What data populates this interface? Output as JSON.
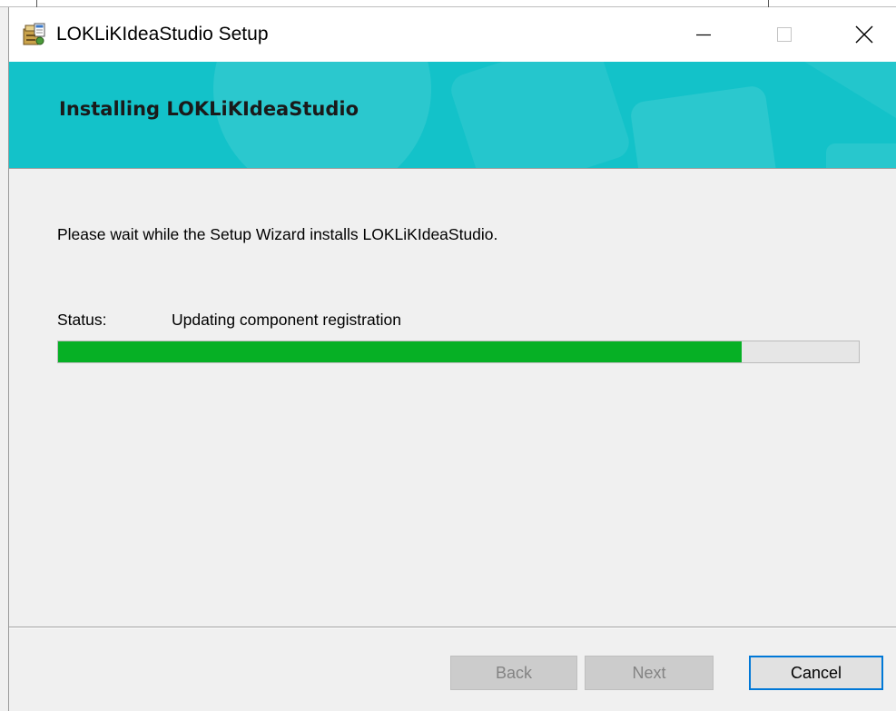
{
  "window": {
    "title": "LOKLiKIdeaStudio Setup",
    "icon": "installer-package-icon"
  },
  "controls": {
    "minimize_icon": "minimize-icon",
    "maximize_icon": "maximize-icon",
    "close_icon": "close-icon"
  },
  "banner": {
    "title": "Installing LOKLiKIdeaStudio",
    "color": "#13c2c9"
  },
  "main": {
    "description": "Please wait while the Setup Wizard installs LOKLiKIdeaStudio.",
    "status_label": "Status:",
    "status_value": "Updating component registration",
    "progress": {
      "percent": 85.4,
      "fill_color": "#06b025"
    }
  },
  "footer": {
    "back_label": "Back",
    "next_label": "Next",
    "cancel_label": "Cancel",
    "focus_color": "#0078d7"
  }
}
